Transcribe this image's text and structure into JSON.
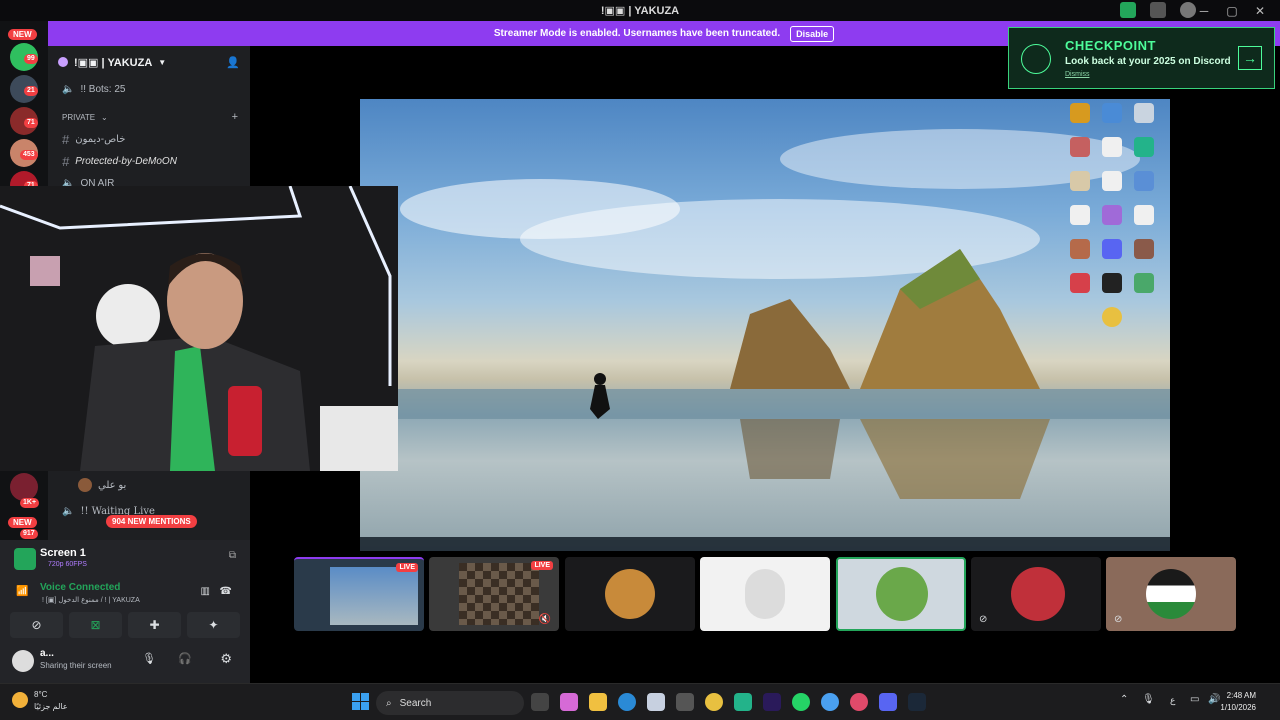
{
  "window": {
    "title": "!▣▣ | YAKUZA"
  },
  "streamer_banner": {
    "text": "Streamer Mode is enabled. Usernames have been truncated.",
    "button": "Disable"
  },
  "servers": {
    "new_top": "NEW",
    "new_bottom": "NEW",
    "badges": [
      "99",
      "21",
      "71",
      "453",
      "71",
      "1K+",
      "917"
    ]
  },
  "guild": {
    "name": "!▣▣ | YAKUZA",
    "bots_channel": "!! Bots: 25",
    "category": "PRIVATE",
    "channels": [
      "خاص-ديمون",
      "Protected-by-DeMoON",
      "ON AIR"
    ],
    "waiting_channel": "!! Waiting Live",
    "voice_user": "بو علي",
    "mentions_pill": "904 NEW MENTIONS"
  },
  "screen_share": {
    "title": "Screen 1",
    "quality": "720p 60FPS"
  },
  "voice": {
    "status": "Voice Connected",
    "channel": "! [▣] ممنوع الدخول / ! | YAKUZA"
  },
  "user": {
    "name": "a...",
    "status": "Sharing their screen"
  },
  "checkpoint": {
    "title": "CHECKPOINT",
    "subtitle": "Look back at your 2025 on Discord",
    "dismiss": "Dismiss"
  },
  "tiles": {
    "live_label": "LIVE"
  },
  "taskbar": {
    "weather_temp": "8°C",
    "weather_label": "عالم جزئيًا",
    "search_label": "Search",
    "lang": "ع",
    "time": "2:48 AM",
    "date": "1/10/2026"
  },
  "colors": {
    "accent": "#8e3cf0",
    "danger": "#f23f42",
    "checkpoint_green": "#4dfc9a",
    "voice_green": "#23a55a"
  }
}
